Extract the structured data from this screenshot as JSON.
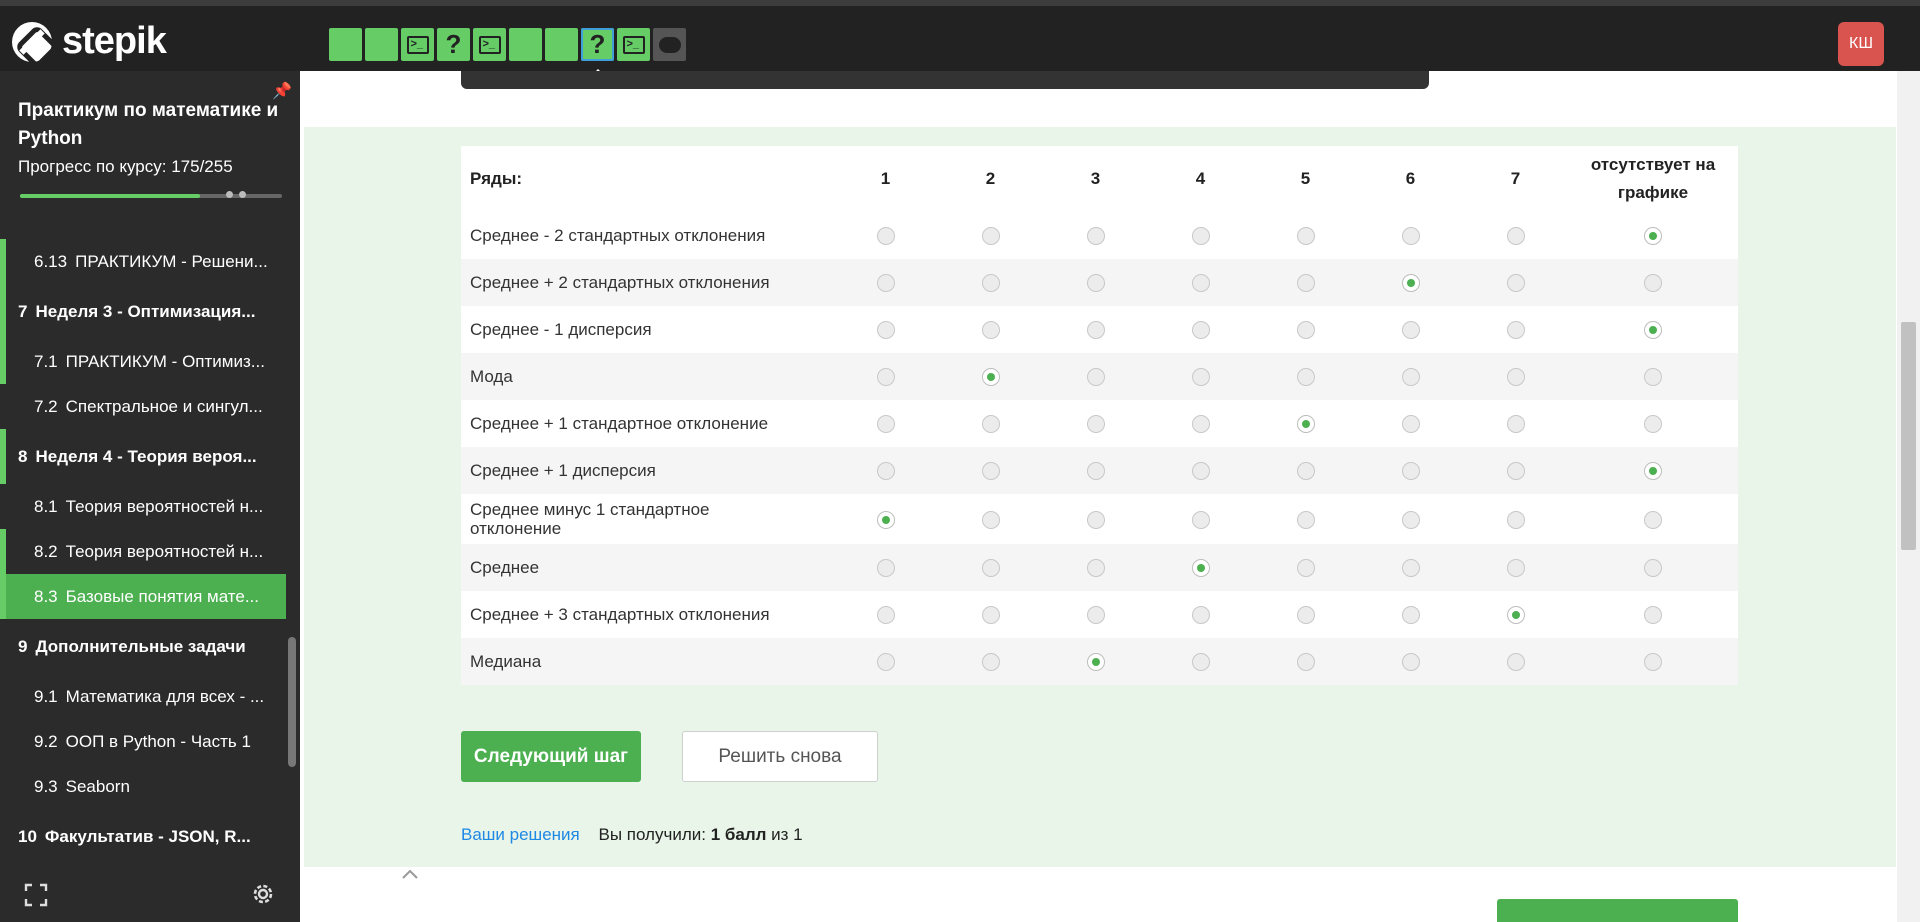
{
  "header": {
    "logo_text": "stepik",
    "avatar_initials": "КШ",
    "steps": [
      {
        "kind": "plain",
        "state": "solved"
      },
      {
        "kind": "plain",
        "state": "solved"
      },
      {
        "kind": "code",
        "state": "solved"
      },
      {
        "kind": "quiz",
        "state": "solved",
        "glyph": "?"
      },
      {
        "kind": "code",
        "state": "solved"
      },
      {
        "kind": "plain",
        "state": "solved"
      },
      {
        "kind": "plain",
        "state": "solved"
      },
      {
        "kind": "quiz",
        "state": "current",
        "glyph": "?"
      },
      {
        "kind": "code",
        "state": "solved"
      },
      {
        "kind": "discussion",
        "state": "unvisited"
      }
    ]
  },
  "sidebar": {
    "course_title": "Практикум по математике и Python",
    "progress_label": "Прогресс по курсу:",
    "progress_value": "175/255",
    "progress_fraction": 0.686,
    "items": [
      {
        "num": "6.13",
        "label": "ПРАКТИКУМ - Решени...",
        "type": "lesson",
        "edge": true,
        "current": false
      },
      {
        "num": "7",
        "label": "Неделя 3 - Оптимизация...",
        "type": "section",
        "edge": true,
        "current": false
      },
      {
        "num": "7.1",
        "label": "ПРАКТИКУМ - Оптимиз...",
        "type": "lesson",
        "edge": true,
        "current": false
      },
      {
        "num": "7.2",
        "label": "Спектральное и сингул...",
        "type": "lesson",
        "edge": false,
        "current": false
      },
      {
        "num": "8",
        "label": "Неделя 4 - Теория вероя...",
        "type": "section",
        "edge": true,
        "current": false
      },
      {
        "num": "8.1",
        "label": "Теория вероятностей н...",
        "type": "lesson",
        "edge": false,
        "current": false
      },
      {
        "num": "8.2",
        "label": "Теория вероятностей н...",
        "type": "lesson",
        "edge": true,
        "current": false
      },
      {
        "num": "8.3",
        "label": "Базовые понятия мате...",
        "type": "lesson",
        "edge": true,
        "current": true
      },
      {
        "num": "9",
        "label": "Дополнительные задачи",
        "type": "section",
        "edge": false,
        "current": false
      },
      {
        "num": "9.1",
        "label": "Математика для всех - ...",
        "type": "lesson",
        "edge": false,
        "current": false
      },
      {
        "num": "9.2",
        "label": "ООП в Python - Часть 1",
        "type": "lesson",
        "edge": false,
        "current": false
      },
      {
        "num": "9.3",
        "label": "Seaborn",
        "type": "lesson",
        "edge": false,
        "current": false
      },
      {
        "num": "10",
        "label": "Факультатив - JSON, R...",
        "type": "section",
        "edge": false,
        "current": false
      }
    ]
  },
  "quiz": {
    "rows_header": "Ряды:",
    "columns": [
      "1",
      "2",
      "3",
      "4",
      "5",
      "6",
      "7",
      "отсутствует на графике"
    ],
    "rows": [
      {
        "label": "Среднее - 2 стандартных отклонения",
        "selected": 7
      },
      {
        "label": "Среднее + 2 стандартных отклонения",
        "selected": 5
      },
      {
        "label": "Среднее - 1 дисперсия",
        "selected": 7
      },
      {
        "label": "Мода",
        "selected": 1
      },
      {
        "label": "Среднее + 1 стандартное отклонение",
        "selected": 4
      },
      {
        "label": "Среднее + 1 дисперсия",
        "selected": 7
      },
      {
        "label": "Среднее минус 1 стандартное отклонение",
        "selected": 0
      },
      {
        "label": "Среднее",
        "selected": 3
      },
      {
        "label": "Среднее + 3 стандартных отклонения",
        "selected": 6
      },
      {
        "label": "Медиана",
        "selected": 2
      }
    ],
    "next_button": "Следующий шаг",
    "retry_button": "Решить снова",
    "solutions_link": "Ваши решения",
    "score_prefix": "Вы получили:",
    "score_value": "1 балл",
    "score_suffix": "из 1"
  },
  "colors": {
    "accent": "#4caf50",
    "quiz_background": "#e8f5e8",
    "sidebar_background": "#2b2b2b",
    "topbar_background": "#222222",
    "avatar_background": "#d9534f",
    "link": "#1e88e5"
  }
}
